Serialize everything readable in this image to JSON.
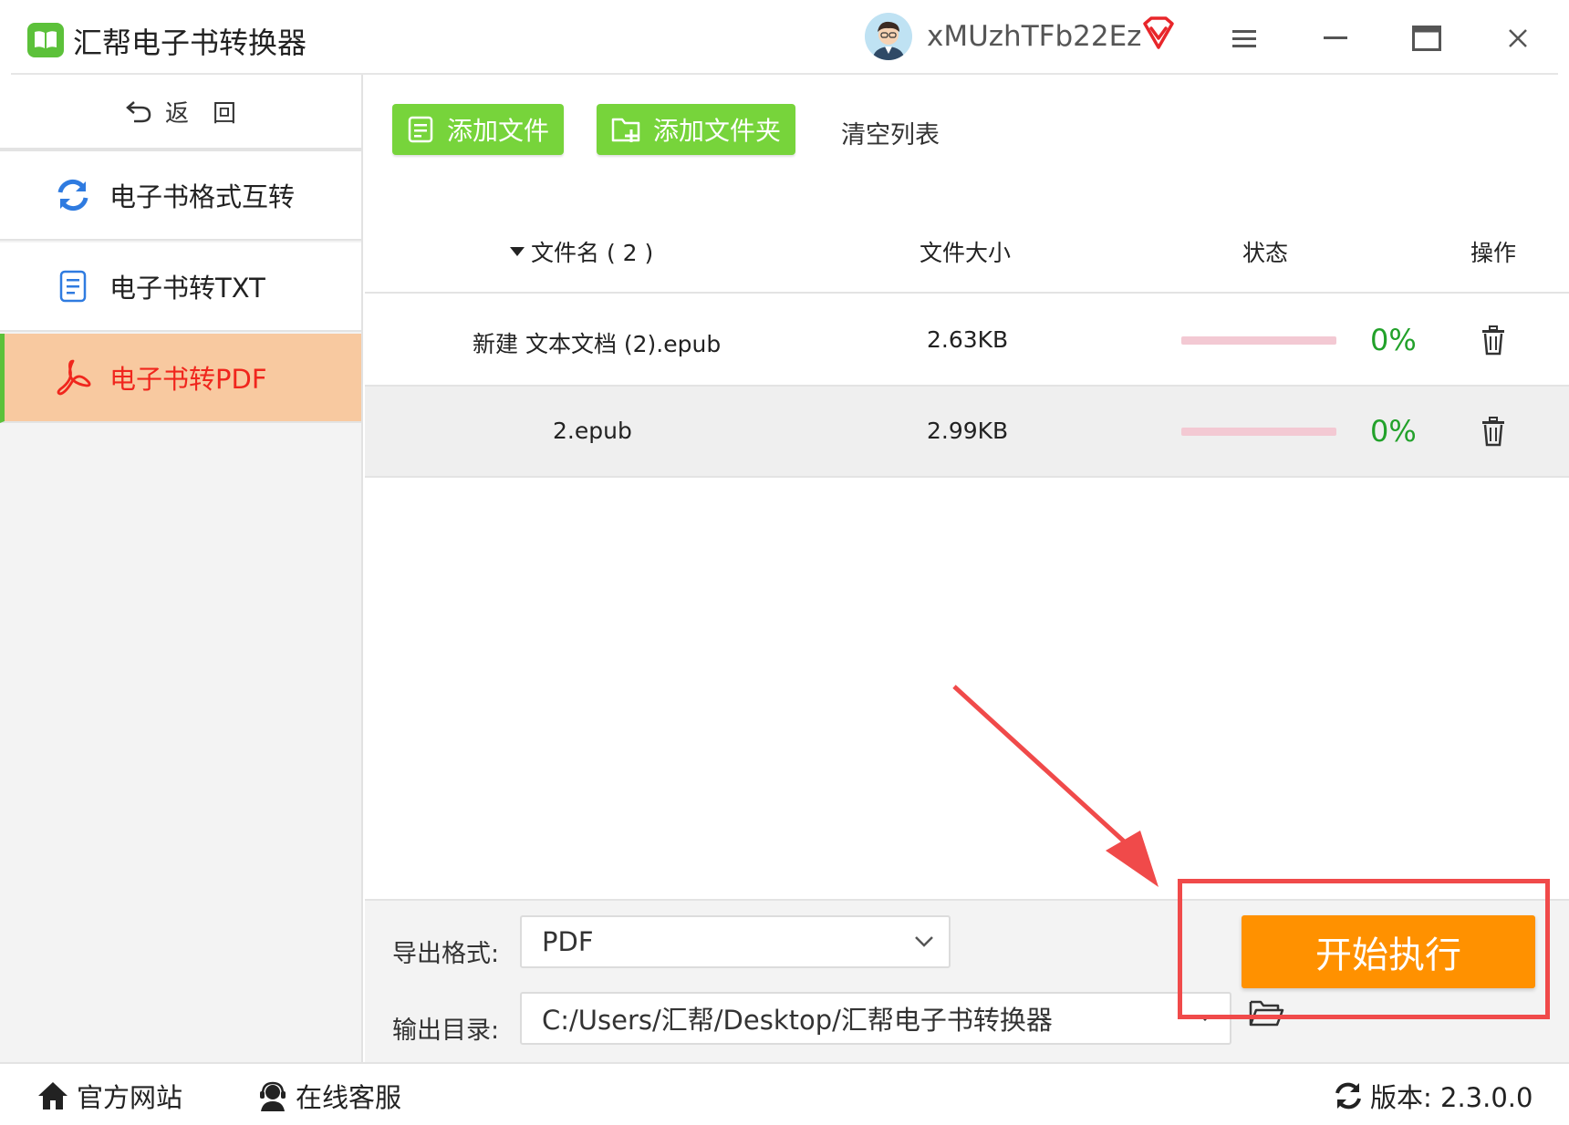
{
  "app": {
    "title": "汇帮电子书转换器",
    "username": "xMUzhTFb22Ez"
  },
  "sidebar": {
    "back_label": "返　回",
    "items": [
      {
        "label": "电子书格式互转",
        "icon": "refresh-icon",
        "active": false
      },
      {
        "label": "电子书转TXT",
        "icon": "document-icon",
        "active": false
      },
      {
        "label": "电子书转PDF",
        "icon": "pdf-icon",
        "active": true
      }
    ]
  },
  "toolbar": {
    "add_file_label": "添加文件",
    "add_folder_label": "添加文件夹",
    "clear_label": "清空列表"
  },
  "table": {
    "headers": {
      "filename": "文件名 ( 2 )",
      "size": "文件大小",
      "status": "状态",
      "action": "操作"
    },
    "rows": [
      {
        "name": "新建 文本文档 (2).epub",
        "size": "2.63KB",
        "progress": 0,
        "percent": "0%"
      },
      {
        "name": "2.epub",
        "size": "2.99KB",
        "progress": 0,
        "percent": "0%"
      }
    ]
  },
  "bottom": {
    "format_label": "导出格式:",
    "format_value": "PDF",
    "output_label": "输出目录:",
    "output_value": "C:/Users/汇帮/Desktop/汇帮电子书转换器",
    "start_label": "开始执行"
  },
  "footer": {
    "website_label": "官方网站",
    "support_label": "在线客服",
    "version_label": "版本: 2.3.0.0"
  },
  "colors": {
    "brand_green": "#77d43b",
    "accent_orange": "#ff9100",
    "active_item_bg": "#f8c9a0",
    "active_item_text": "#f0261d",
    "percent_green": "#22a12a",
    "highlight_red": "#f04a4a"
  }
}
